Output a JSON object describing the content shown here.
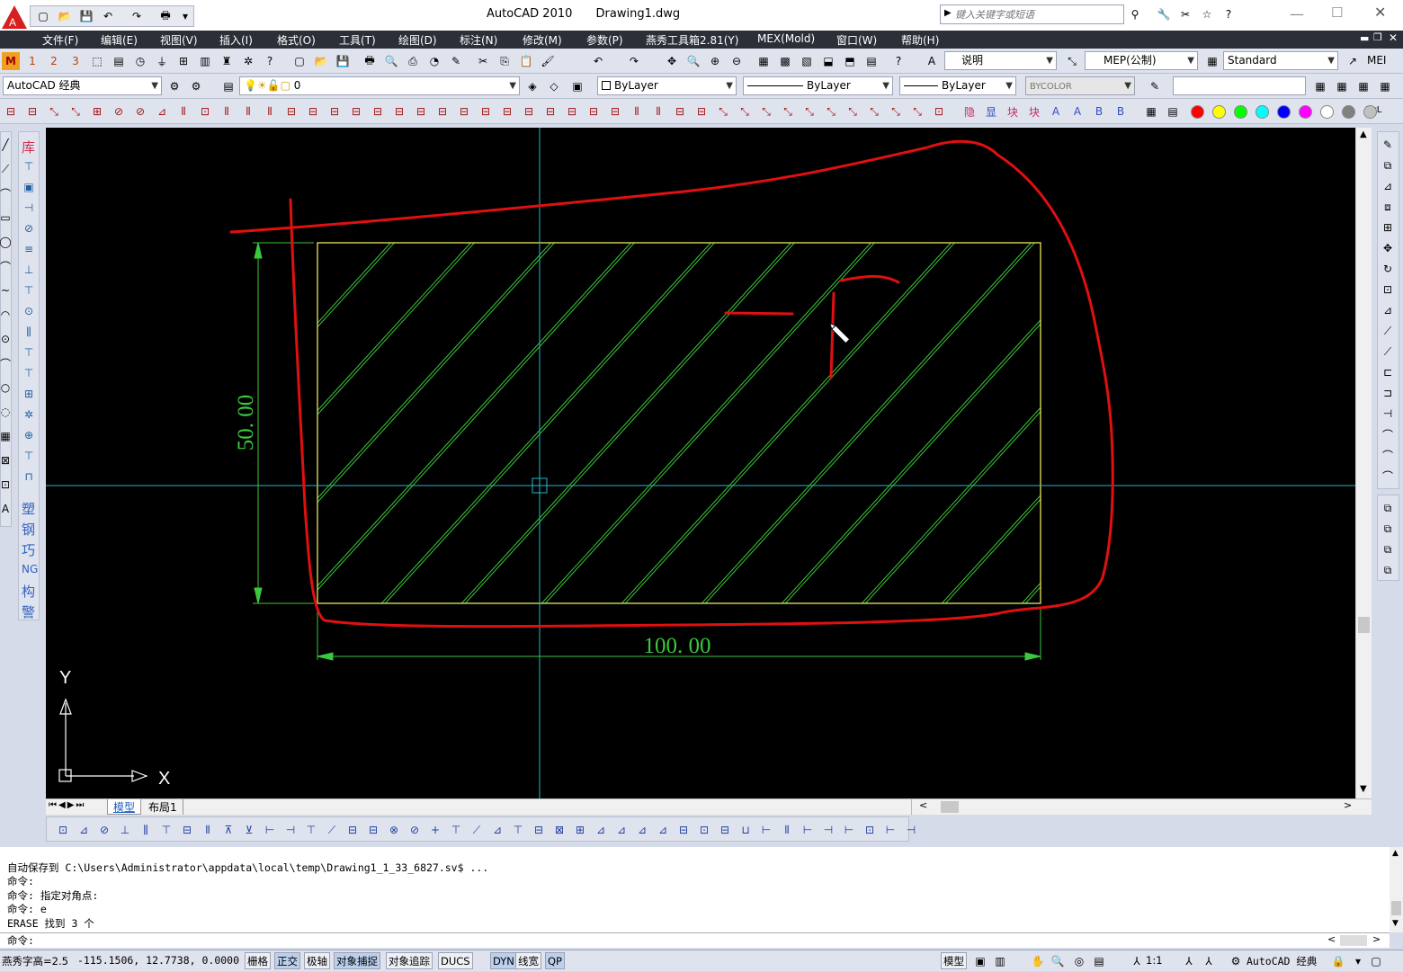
{
  "title_bar": {
    "app_name": "AutoCAD 2010",
    "document": "Drawing1.dwg",
    "search_placeholder": "键入关键字或短语"
  },
  "menu": [
    "文件(F)",
    "编辑(E)",
    "视图(V)",
    "插入(I)",
    "格式(O)",
    "工具(T)",
    "绘图(D)",
    "标注(N)",
    "修改(M)",
    "参数(P)",
    "燕秀工具箱2.81(Y)",
    "MEX(Mold)",
    "窗口(W)",
    "帮助(H)"
  ],
  "toolbar1": {
    "text_style_label": "说明",
    "dim_style": "MEP(公制)",
    "table_style": "Standard",
    "multileader_style_partial": "MEI"
  },
  "toolbar2": {
    "workspace": "AutoCAD 经典",
    "layer": "0",
    "color": "ByLayer",
    "linetype": "ByLayer",
    "lineweight": "ByLayer",
    "plotstyle": "BYCOLOR"
  },
  "palette_colors": [
    "#ff0000",
    "#ffff00",
    "#00ff00",
    "#00ffff",
    "#0000ff",
    "#ff00ff",
    "#ffffff",
    "#808080",
    "#c0c0c0"
  ],
  "palette_tail": "ByL",
  "left_vertical_labels": [
    "库",
    "塑",
    "钢",
    "巧",
    "NG",
    "构",
    "警"
  ],
  "drawing": {
    "dim_vertical": "50. 00",
    "dim_horizontal": "100. 00",
    "ucs_x": "X",
    "ucs_y": "Y"
  },
  "tabs": {
    "model": "模型",
    "layout": "布局1"
  },
  "command_history": [
    "自动保存到 C:\\Users\\Administrator\\appdata\\local\\temp\\Drawing1_1_33_6827.sv$ ...",
    "命令:",
    "命令: 指定对角点:",
    "命令: e",
    "ERASE 找到 3 个"
  ],
  "command_prompt": "命令:",
  "status": {
    "left_text": "燕秀字高=2.5",
    "coordinates": "-115.1506, 12.7738, 0.0000",
    "toggles": [
      {
        "label": "栅格",
        "on": false
      },
      {
        "label": "正交",
        "on": true
      },
      {
        "label": "极轴",
        "on": false
      },
      {
        "label": "对象捕捉",
        "on": true
      },
      {
        "label": "对象追踪",
        "on": false
      },
      {
        "label": "DUCS",
        "on": false
      },
      {
        "label": "DYN",
        "on": true
      },
      {
        "label": "线宽",
        "on": false
      },
      {
        "label": "QP",
        "on": true
      }
    ],
    "model_label": "模型",
    "scale": "1:1",
    "workspace": "AutoCAD 经典"
  }
}
